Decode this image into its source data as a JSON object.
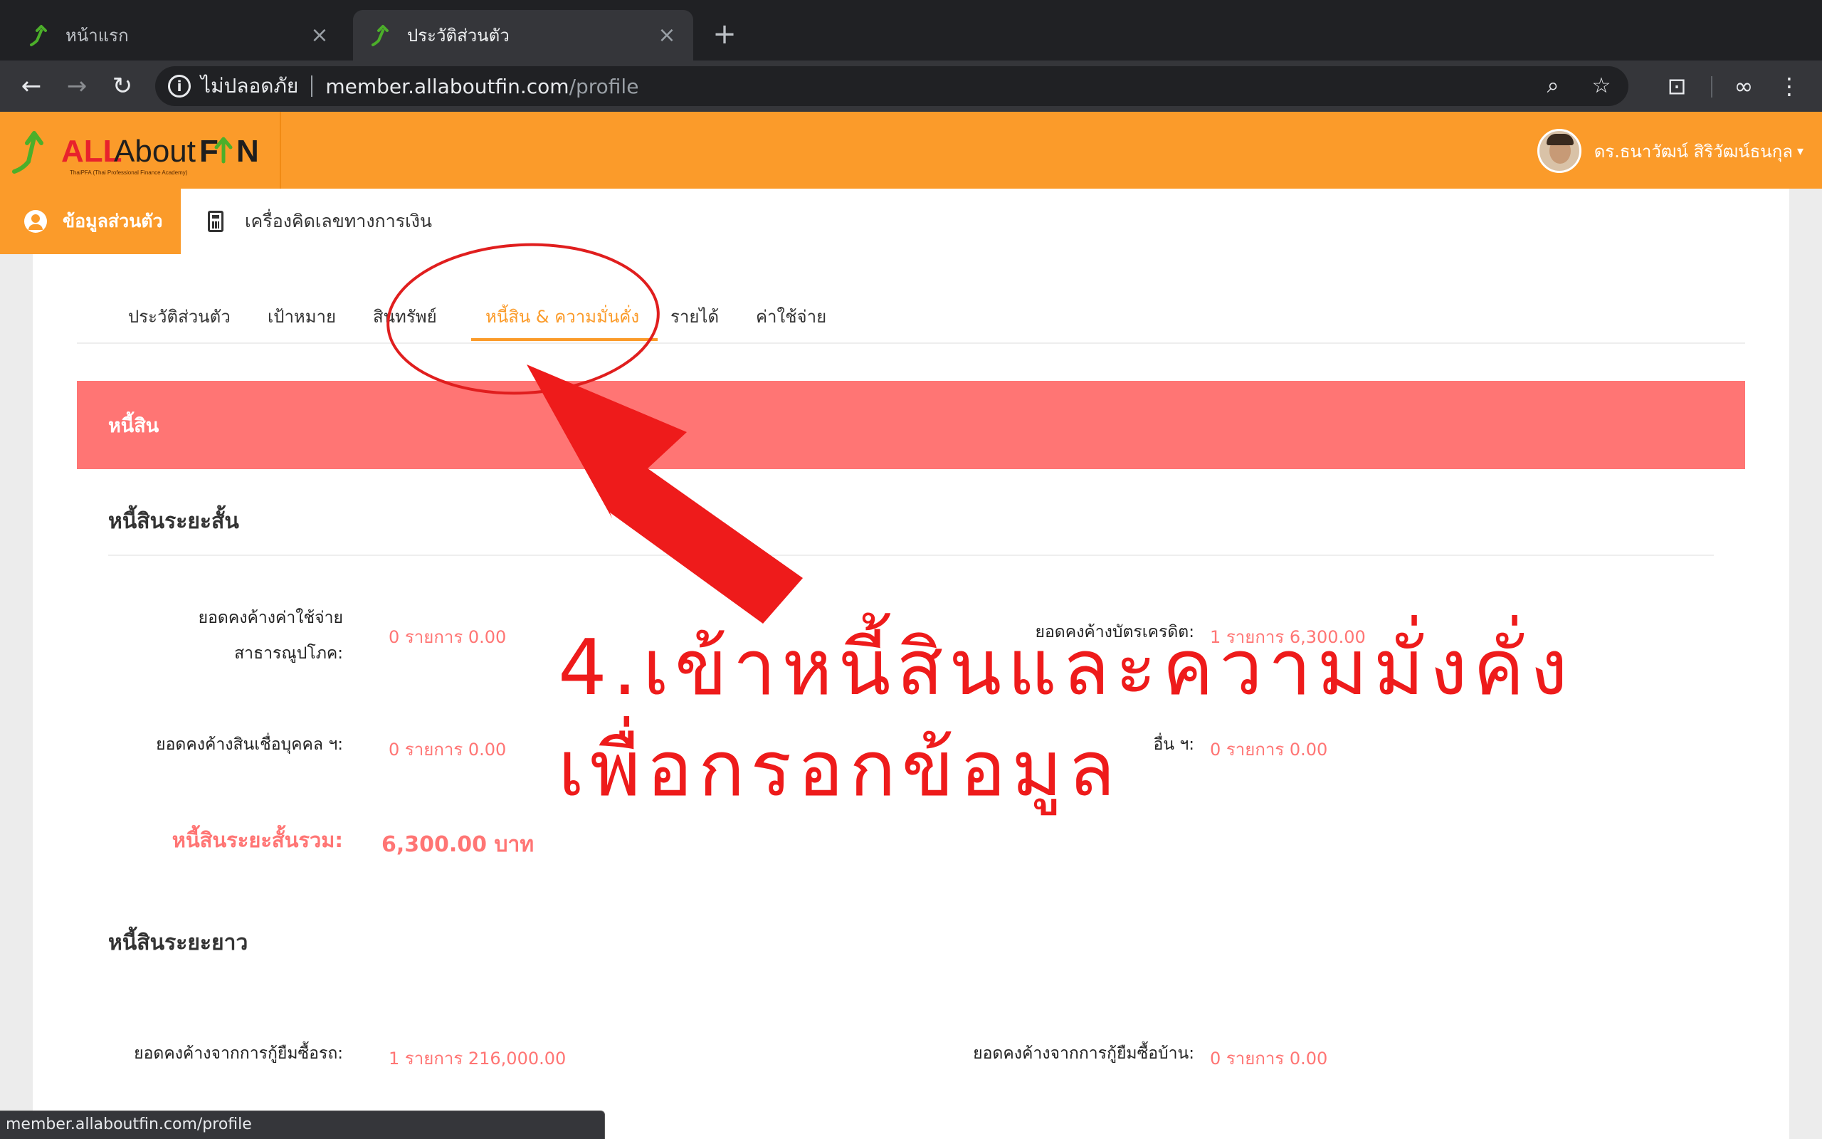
{
  "browser": {
    "tabs": [
      {
        "title": "หน้าแรก",
        "active": false
      },
      {
        "title": "ประวัติส่วนตัว",
        "active": true
      }
    ],
    "new_tab_label": "+",
    "security_text": "ไม่ปลอดภัย",
    "url_host": "member.allaboutfin.com",
    "url_path": "/profile",
    "status_url": "member.allaboutfin.com/profile"
  },
  "site": {
    "brand_colors": {
      "orange": "#fb9b2a",
      "coral": "#ff7574",
      "green": "#4caf2a"
    },
    "logo_text_all": "ALL",
    "logo_text_about": "About",
    "logo_text_f": "F",
    "logo_text_n": "N",
    "logo_tagline": "ThaiPFA (Thai Professional Finance Academy)",
    "user_name": "ดร.ธนาวัฒน์ สิริวัฒน์ธนกุล",
    "subnav": {
      "personal": "ข้อมูลส่วนตัว",
      "calculator": "เครื่องคิดเลขทางการเงิน"
    }
  },
  "profile_tabs": [
    {
      "label": "ประวัติส่วนตัว"
    },
    {
      "label": "เป้าหมาย"
    },
    {
      "label": "สินทรัพย์"
    },
    {
      "label": "หนี้สิน & ความมั่นคั่ง",
      "active": true
    },
    {
      "label": "รายได้"
    },
    {
      "label": "ค่าใช้จ่าย"
    }
  ],
  "debt": {
    "banner": "หนี้สิน",
    "short_term": {
      "title": "หนี้สินระยะสั้น",
      "utilities_label_1": "ยอดคงค้างค่าใช้จ่าย",
      "utilities_label_2": "สาธารณูปโภค:",
      "utilities_value": "0 รายการ 0.00",
      "credit_label": "ยอดคงค้างบัตรเครดิต:",
      "credit_value": "1 รายการ 6,300.00",
      "personal_loan_label": "ยอดคงค้างสินเชื่อบุคคล ฯ:",
      "personal_loan_value": "0 รายการ 0.00",
      "other_label": "อื่น ฯ:",
      "other_value": "0 รายการ 0.00",
      "total_label": "หนี้สินระยะสั้นรวม:",
      "total_value": "6,300.00 บาท"
    },
    "long_term": {
      "title": "หนี้สินระยะยาว",
      "car_label": "ยอดคงค้างจากการกู้ยืมซื้อรถ:",
      "car_value": "1 รายการ 216,000.00",
      "house_label": "ยอดคงค้างจากการกู้ยืมซื้อบ้าน:",
      "house_value": "0 รายการ 0.00"
    }
  },
  "annotation": {
    "line1": "4.เข้าหนี้สินและความมั่งคั่ง",
    "line2": "เพื่อกรอกข้อมูล",
    "color": "#ee1b1b"
  }
}
